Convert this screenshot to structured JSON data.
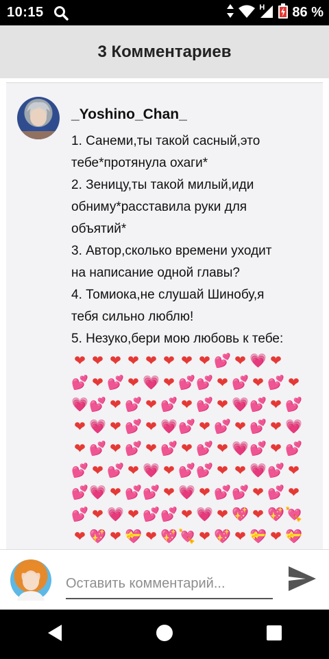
{
  "status_bar": {
    "time": "10:15",
    "network": "H",
    "battery_text": "86 %",
    "icons": [
      "search-icon",
      "vibrate-icon",
      "wifi-icon",
      "signal-icon",
      "battery-icon"
    ]
  },
  "header": {
    "title": "3 Комментариев"
  },
  "comment": {
    "author": "_Yoshino_Chan_",
    "lines": [
      "1. Санеми,ты такой сасный,это",
      "тебе*протянула охаги*",
      "2. Зеницу,ты такой милый,иди",
      "обниму*расставила руки для",
      "объятий*",
      "3. Автор,сколько  времени уходит",
      "на написание одной главы?",
      "4. Томиока,не слушай Шинобу,я",
      "тебя сильно люблю!",
      "5. Незуко,бери мою любовь к тебе:"
    ],
    "heart_rows": [
      [
        "❤",
        "❤",
        "❤",
        "❤",
        "❤",
        "❤",
        "❤",
        "❤",
        "💕",
        "❤",
        "💗",
        "❤"
      ],
      [
        "💕",
        "❤",
        "💕",
        "❤",
        "💗",
        "❤",
        "💕",
        "💕",
        "❤",
        "💕",
        "❤",
        "💕",
        "❤"
      ],
      [
        "💗",
        "💕",
        "❤",
        "💕",
        "❤",
        "💕",
        "❤",
        "💕",
        "❤",
        "💗",
        "💕",
        "❤",
        "💕"
      ],
      [
        "❤",
        "💗",
        "❤",
        "💕",
        "❤",
        "💗",
        "💕",
        "❤",
        "💕",
        "❤",
        "💕",
        "❤",
        "💗"
      ],
      [
        "❤",
        "💕",
        "❤",
        "💕",
        "❤",
        "💕",
        "❤",
        "💕",
        "❤",
        "💗",
        "💕",
        "❤",
        "💕"
      ],
      [
        "💕",
        "❤",
        "💕",
        "❤",
        "💗",
        "❤",
        "💕",
        "💕",
        "❤",
        "❤",
        "💗",
        "💕",
        "❤"
      ],
      [
        "💕",
        "💗",
        "❤",
        "💕",
        "💕",
        "❤",
        "💗",
        "❤",
        "💕",
        "💕",
        "❤",
        "💕",
        "❤"
      ],
      [
        "💕",
        "❤",
        "💗",
        "❤",
        "💕",
        "💕",
        "❤",
        "💗",
        "❤",
        "💖",
        "❤",
        "💖",
        "💘"
      ],
      [
        "❤",
        "💖",
        "❤",
        "💝",
        "❤",
        "💖",
        "💘",
        "❤",
        "💖",
        "❤",
        "💝",
        "❤",
        "💝"
      ]
    ]
  },
  "composer": {
    "placeholder": "Оставить комментарий...",
    "send_icon": "send-icon"
  },
  "nav_bar": {
    "icons": [
      "back-icon",
      "home-icon",
      "recents-icon"
    ]
  },
  "colors": {
    "header_bg": "#e3e3e3",
    "card_bg": "#f3f2f5",
    "heart": "#e53935",
    "send": "#555555"
  }
}
